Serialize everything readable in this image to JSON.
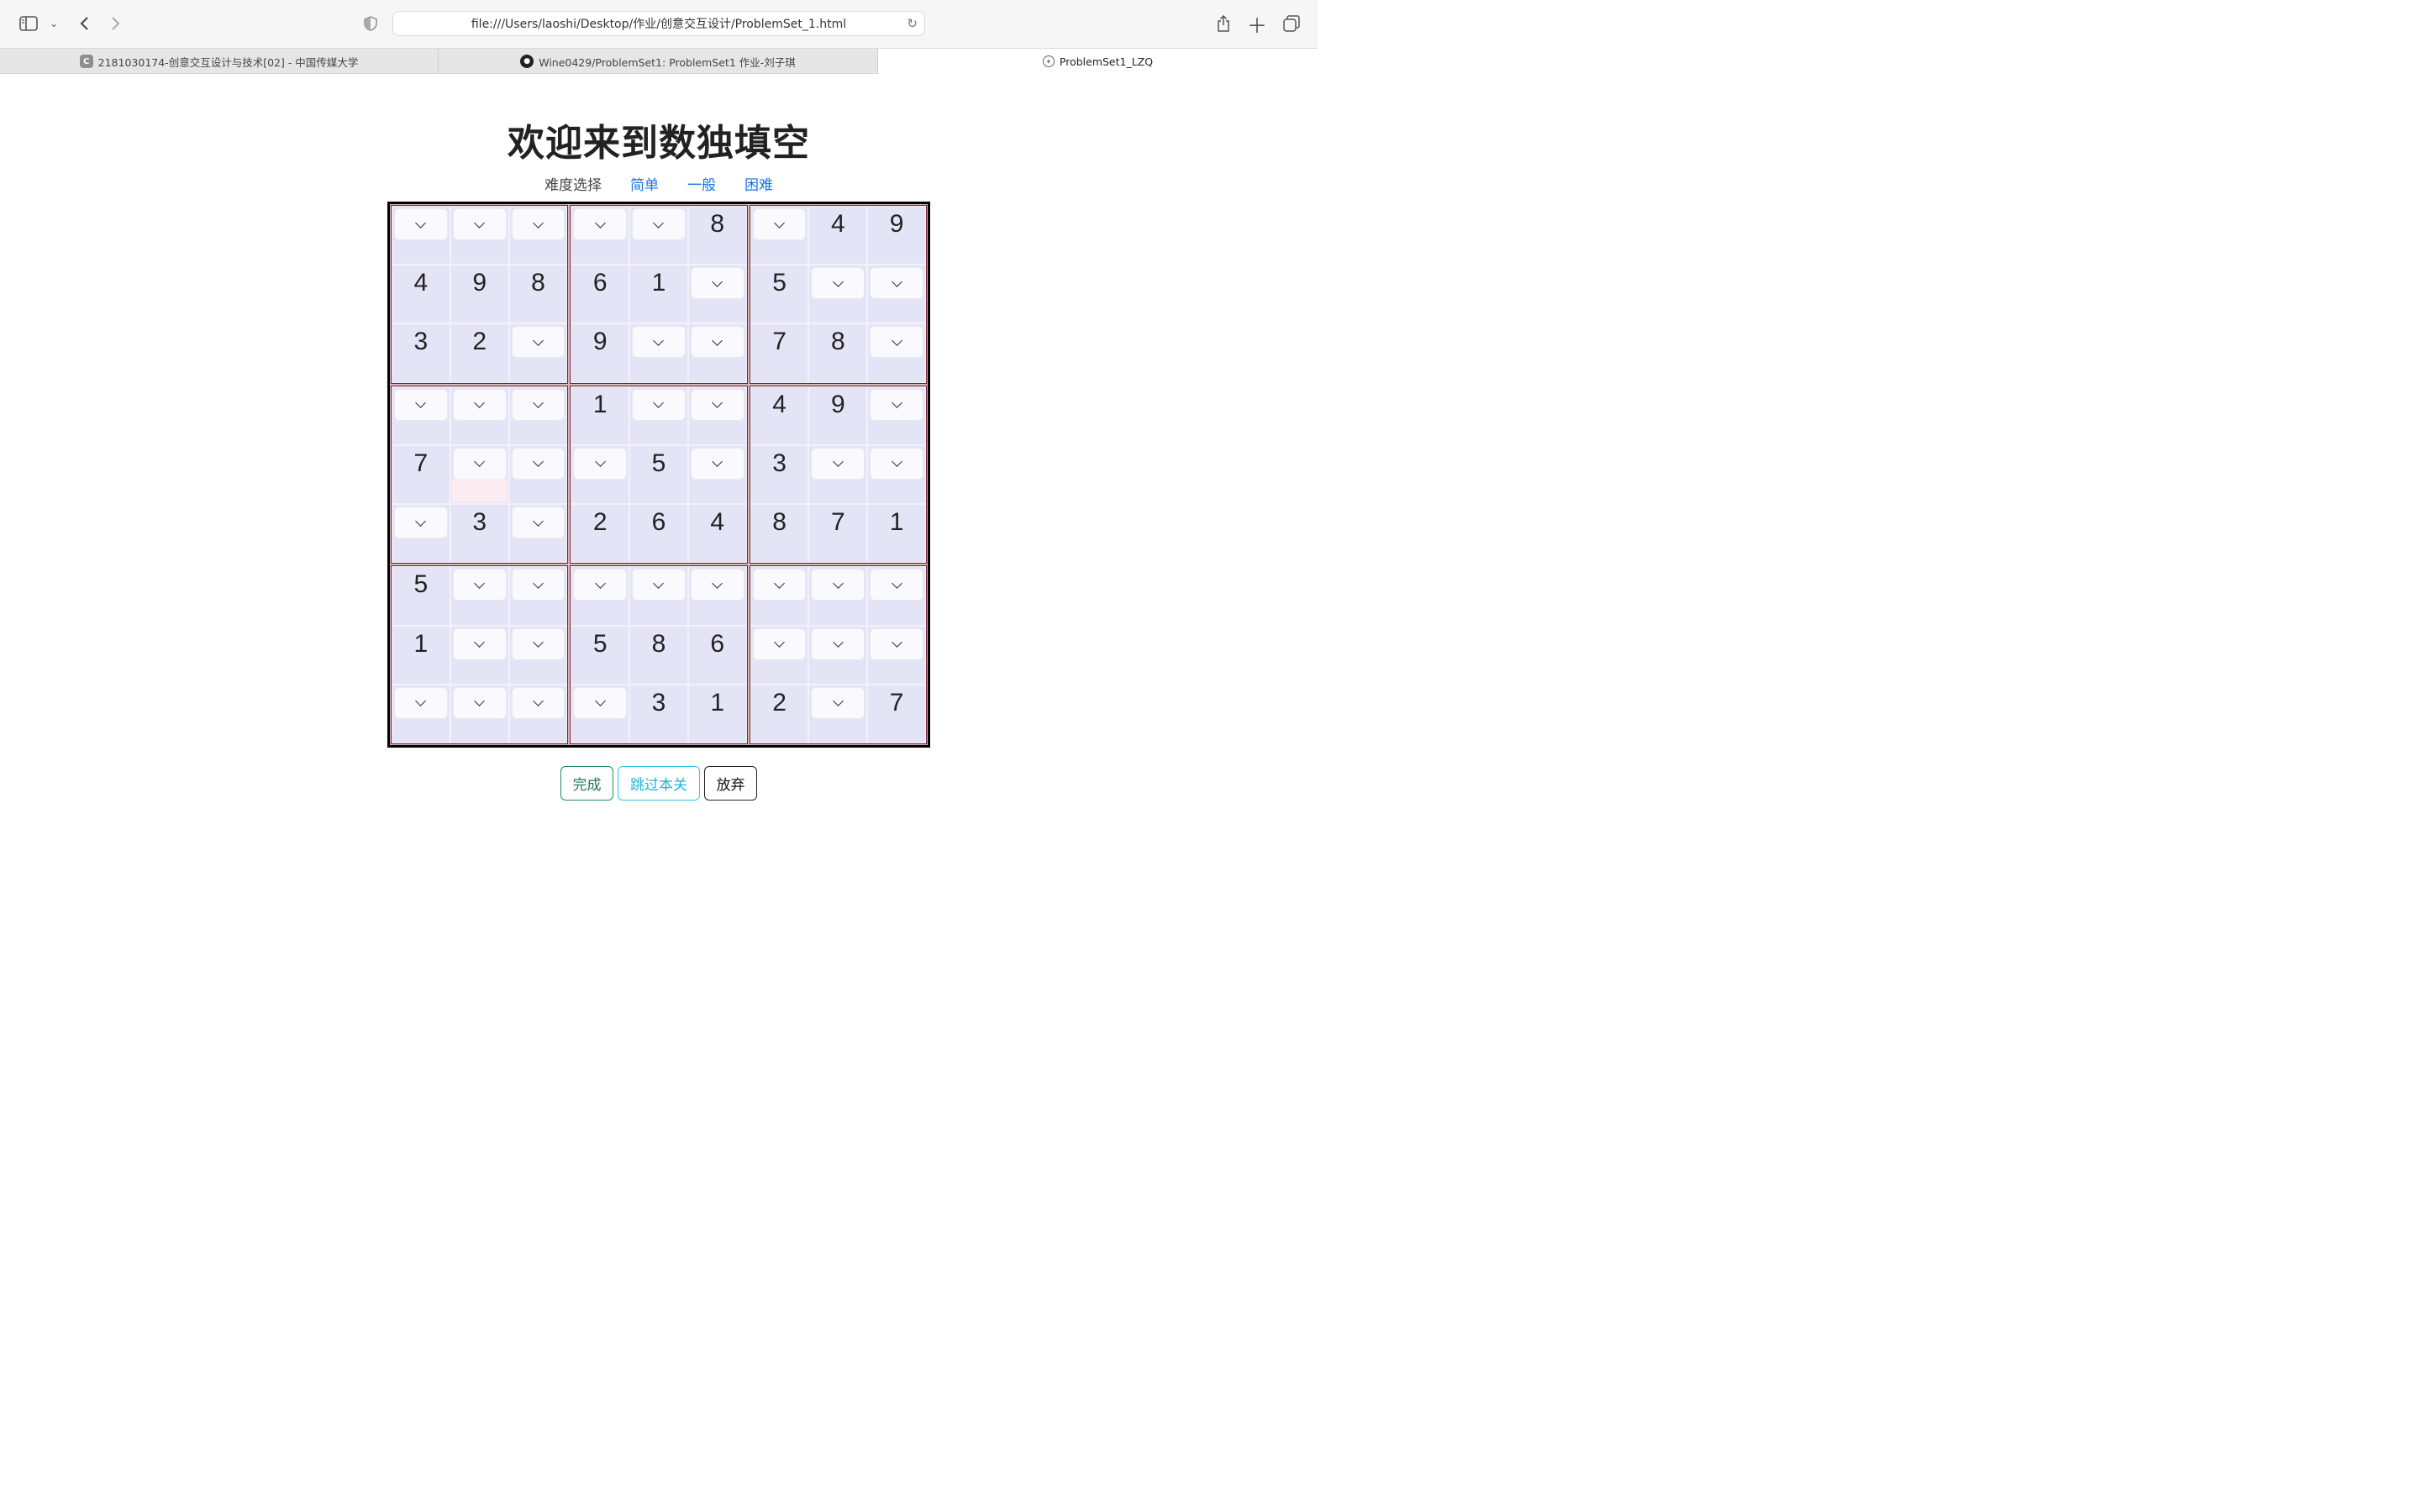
{
  "browser": {
    "url": "file:///Users/laoshi/Desktop/作业/创意交互设计/ProblemSet_1.html",
    "tabs": [
      {
        "label": "2181030174-创意交互设计与技术[02] - 中国传媒大学",
        "favicon": "C"
      },
      {
        "label": "Wine0429/ProblemSet1: ProblemSet1 作业-刘子琪",
        "favicon": "github-icon"
      },
      {
        "label": "ProblemSet1_LZQ",
        "favicon": "compass-icon"
      }
    ]
  },
  "page": {
    "title": "欢迎来到数独填空",
    "difficulty_label": "难度选择",
    "difficulty_options": [
      "简单",
      "一般",
      "困难"
    ]
  },
  "sudoku": {
    "rows": [
      [
        "",
        "",
        "",
        "",
        "",
        "8",
        "",
        "4",
        "9"
      ],
      [
        "4",
        "9",
        "8",
        "6",
        "1",
        "",
        "5",
        "",
        ""
      ],
      [
        "3",
        "2",
        "",
        "9",
        "",
        "",
        "7",
        "8",
        ""
      ],
      [
        "",
        "",
        "",
        "1",
        "",
        "",
        "4",
        "9",
        ""
      ],
      [
        "7",
        "",
        "",
        "",
        "5",
        "",
        "3",
        "",
        ""
      ],
      [
        "",
        "3",
        "",
        "2",
        "6",
        "4",
        "8",
        "7",
        "1"
      ],
      [
        "5",
        "",
        "",
        "",
        "",
        "",
        "",
        "",
        ""
      ],
      [
        "1",
        "",
        "",
        "5",
        "8",
        "6",
        "",
        "",
        ""
      ],
      [
        "",
        "",
        "",
        "",
        "3",
        "1",
        "2",
        "",
        "7"
      ]
    ]
  },
  "actions": {
    "done": "完成",
    "skip": "跳过本关",
    "quit": "放弃"
  },
  "colors": {
    "link": "#1a73e8",
    "cell_bg": "#e4e4f7",
    "box_border": "#7a1d2e",
    "done_button": "#1e8a5b",
    "skip_button": "#34c6e6"
  }
}
